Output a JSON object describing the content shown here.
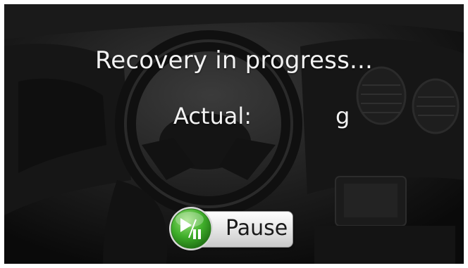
{
  "status": {
    "headline": "Recovery in progress..."
  },
  "reading": {
    "label": "Actual:",
    "value": "",
    "unit": "g"
  },
  "controls": {
    "pause_label": "Pause",
    "pause_icon": "play-pause-icon"
  },
  "colors": {
    "text": "#f2f2f2",
    "button_green": "#3fae2a",
    "button_face": "#e9e9e9"
  }
}
